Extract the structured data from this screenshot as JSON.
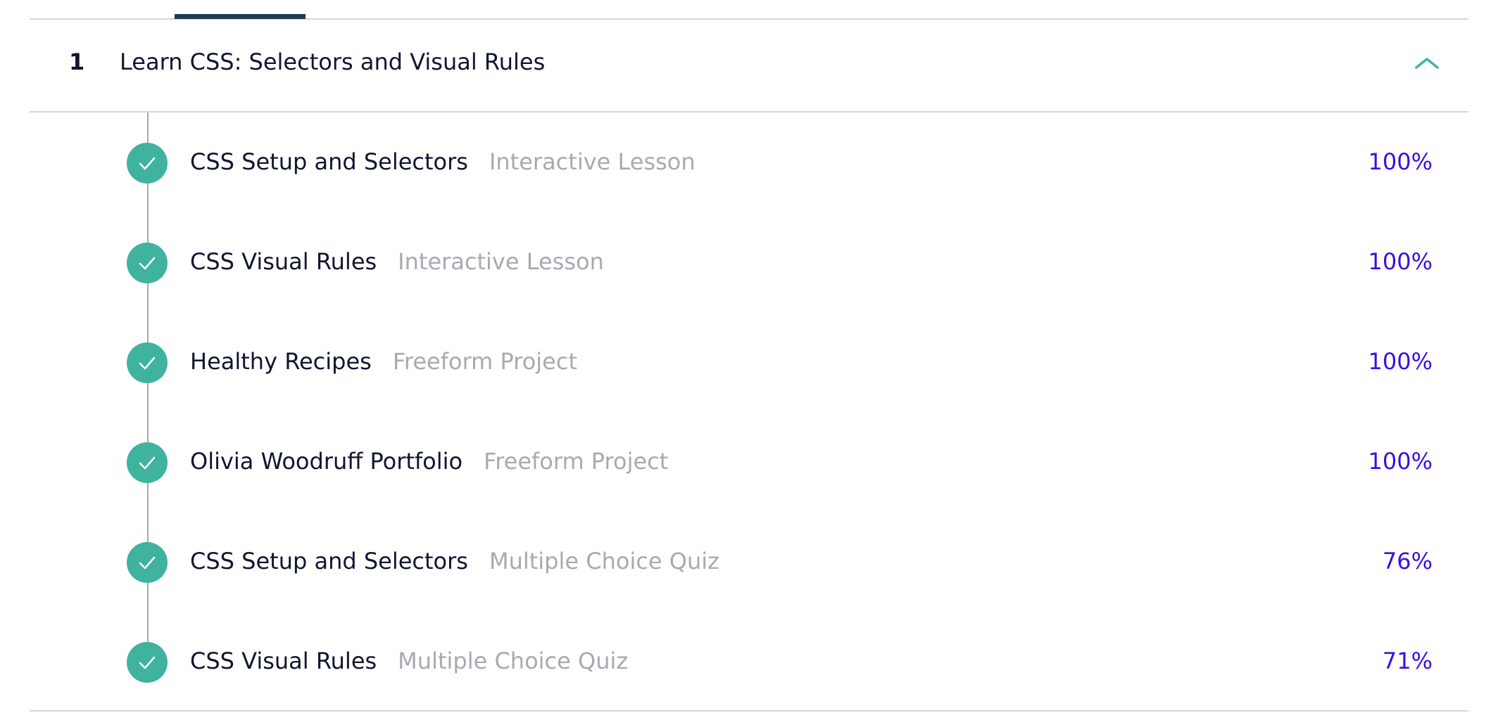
{
  "module": {
    "number": "1",
    "title": "Learn CSS: Selectors and Visual Rules",
    "expanded": true,
    "toggle_icon": "chevron-up-icon"
  },
  "lessons": [
    {
      "title": "CSS Setup and Selectors",
      "type": "Interactive Lesson",
      "score": "100%",
      "completed": true
    },
    {
      "title": "CSS Visual Rules",
      "type": "Interactive Lesson",
      "score": "100%",
      "completed": true
    },
    {
      "title": "Healthy Recipes",
      "type": "Freeform Project",
      "score": "100%",
      "completed": true
    },
    {
      "title": "Olivia Woodruff Portfolio",
      "type": "Freeform Project",
      "score": "100%",
      "completed": true
    },
    {
      "title": "CSS Setup and Selectors",
      "type": "Multiple Choice Quiz",
      "score": "76%",
      "completed": true
    },
    {
      "title": "CSS Visual Rules",
      "type": "Multiple Choice Quiz",
      "score": "71%",
      "completed": true
    }
  ],
  "colors": {
    "accent_teal": "#3fb39e",
    "score_purple": "#3a10e5",
    "text_dark": "#10162f",
    "text_muted": "#a9a9b1",
    "active_tab": "#1d3a54"
  }
}
